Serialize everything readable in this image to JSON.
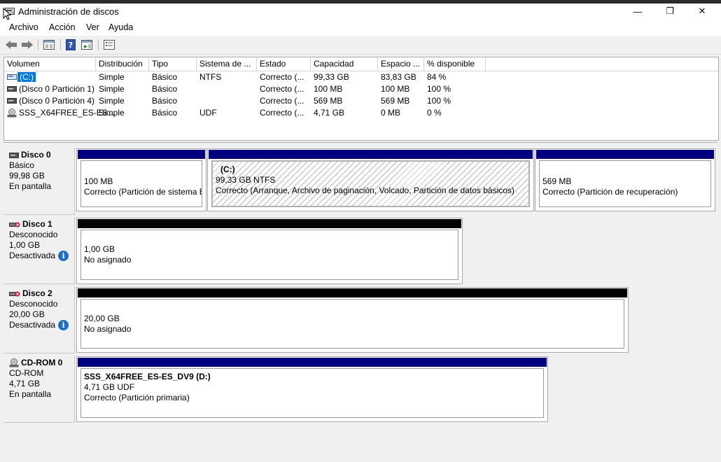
{
  "window": {
    "title": "Administración de discos",
    "minimize_glyph": "—",
    "restore_glyph": "❐",
    "close_glyph": "✕"
  },
  "menu": [
    "Archivo",
    "Acción",
    "Ver",
    "Ayuda"
  ],
  "toolbar_icons": [
    "back-arrow-icon",
    "forward-arrow-icon",
    "console-tree-icon",
    "help-icon",
    "action-pane-icon",
    "properties-icon"
  ],
  "volumes": {
    "columns": [
      "Volumen",
      "Distribución",
      "Tipo",
      "Sistema de ...",
      "Estado",
      "Capacidad",
      "Espacio ...",
      "% disponible"
    ],
    "rows": [
      {
        "name": "(C:)",
        "layout": "Simple",
        "type": "Básico",
        "fs": "NTFS",
        "status": "Correcto (...",
        "capacity": "99,33 GB",
        "free": "83,83 GB",
        "pct": "84 %"
      },
      {
        "name": "(Disco 0 Partición 1)",
        "layout": "Simple",
        "type": "Básico",
        "fs": "",
        "status": "Correcto (...",
        "capacity": "100 MB",
        "free": "100 MB",
        "pct": "100 %"
      },
      {
        "name": "(Disco 0 Partición 4)",
        "layout": "Simple",
        "type": "Básico",
        "fs": "",
        "status": "Correcto (...",
        "capacity": "569 MB",
        "free": "569 MB",
        "pct": "100 %"
      },
      {
        "name": "SSS_X64FREE_ES-ES...",
        "layout": "Simple",
        "type": "Básico",
        "fs": "UDF",
        "status": "Correcto (...",
        "capacity": "4,71 GB",
        "free": "0 MB",
        "pct": "0 %"
      }
    ]
  },
  "disks": {
    "disk0": {
      "name": "Disco 0",
      "type": "Básico",
      "size": "99,98 GB",
      "status": "En pantalla",
      "p1": {
        "size": "100 MB",
        "status": "Correcto (Partición de sistema EFI)"
      },
      "p2": {
        "label": "(C:)",
        "size": "99,33 GB NTFS",
        "status": "Correcto (Arranque, Archivo de paginación, Volcado, Partición de datos básicos)"
      },
      "p3": {
        "size": "569 MB",
        "status": "Correcto (Partición de recuperación)"
      }
    },
    "disk1": {
      "name": "Disco 1",
      "type": "Desconocido",
      "size": "1,00 GB",
      "status": "Desactivada",
      "p1": {
        "size": "1,00 GB",
        "status": "No asignado"
      }
    },
    "disk2": {
      "name": "Disco 2",
      "type": "Desconocido",
      "size": "20,00 GB",
      "status": "Desactivada",
      "p1": {
        "size": "20,00 GB",
        "status": "No asignado"
      }
    },
    "cdrom0": {
      "name": "CD-ROM 0",
      "type": "CD-ROM",
      "size": "4,71 GB",
      "status": "En pantalla",
      "p1": {
        "label": "SSS_X64FREE_ES-ES_DV9  (D:)",
        "size": "4,71 GB UDF",
        "status": "Correcto (Partición primaria)"
      }
    }
  },
  "info_glyph": "i",
  "colors": {
    "primary_bar": "#00007f",
    "unallocated_bar": "#000000",
    "selection": "#0078d7"
  }
}
